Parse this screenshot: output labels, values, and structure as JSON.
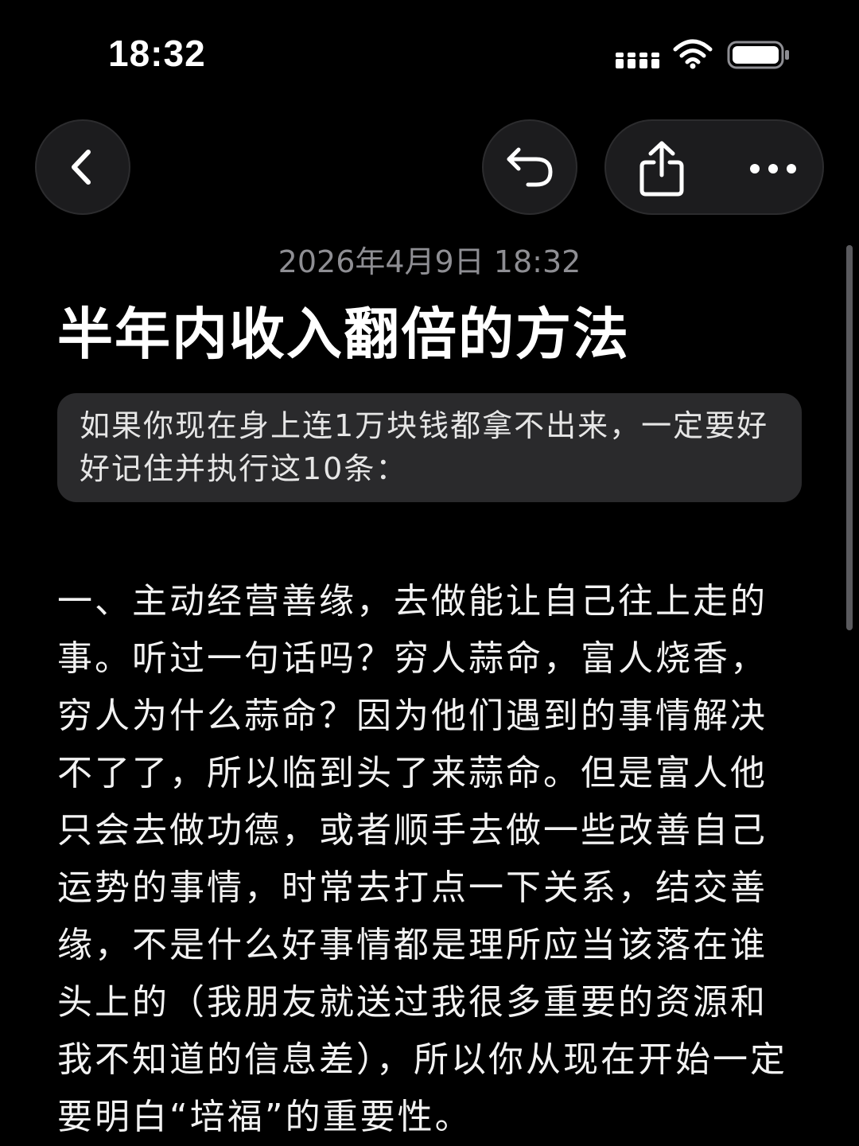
{
  "status_bar": {
    "time": "18:32",
    "icons": [
      "cellular-signal-icon",
      "wifi-icon",
      "battery-icon"
    ]
  },
  "toolbar": {
    "icons": {
      "back": "chevron-left-icon",
      "undo": "undo-arrow-icon",
      "share": "share-icon",
      "more": "ellipsis-icon"
    }
  },
  "note": {
    "date": "2026年4月9日 18:32",
    "title": "半年内收入翻倍的方法",
    "quote": "如果你现在身上连1万块钱都拿不出来，一定要好好记住并执行这10条：",
    "body": "一、主动经营善缘，去做能让自己往上走的事。听过一句话吗？穷人蒜命，富人烧香，穷人为什么蒜命？因为他们遇到的事情解决不了了，所以临到头了来蒜命。但是富人他只会去做功德，或者顺手去做一些改善自己运势的事情，时常去打点一下关系，结交善缘，不是什么好事情都是理所应当该落在谁头上的（我朋友就送过我很多重要的资源和我不知道的信息差），所以你从现在开始一定要明白“培福”的重要性。"
  },
  "colors": {
    "background": "#000000",
    "button_bg": "#1c1c1e",
    "quote_bg": "#2a2a2c",
    "date_text": "#8e8e93"
  }
}
